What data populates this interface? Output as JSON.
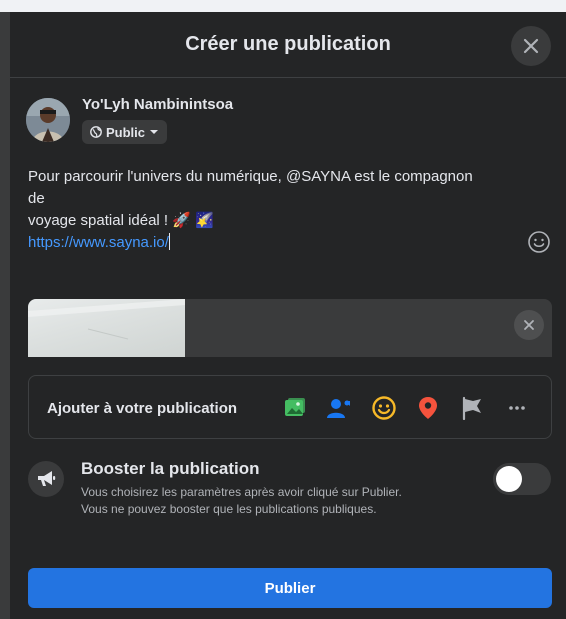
{
  "dialog": {
    "title": "Créer une publication",
    "close_icon": "close-icon"
  },
  "author": {
    "name": "Yo'Lyh Nambinintsoa",
    "audience": "Public",
    "audience_icon": "globe-icon",
    "audience_caret_icon": "caret-down-icon"
  },
  "post": {
    "line1": "Pour parcourir l'univers du numérique, @SAYNA est le compagnon",
    "line2": "de",
    "line3": "voyage spatial idéal ! 🚀 🌠",
    "link": "https://www.sayna.io/"
  },
  "emoji_button_icon": "smiley-outline-icon",
  "link_preview": {
    "remove_icon": "close-icon"
  },
  "add_to_post": {
    "label": "Ajouter à votre publication",
    "icons": [
      {
        "name": "photo-video-icon",
        "color": "#45bd62"
      },
      {
        "name": "tag-people-icon",
        "color": "#1877f2"
      },
      {
        "name": "feeling-activity-icon",
        "color": "#f7b928"
      },
      {
        "name": "check-in-icon",
        "color": "#f5533d"
      },
      {
        "name": "life-event-flag-icon",
        "color": "#b0b3b8"
      },
      {
        "name": "more-icon",
        "color": "#b0b3b8"
      }
    ]
  },
  "boost": {
    "title": "Booster la publication",
    "desc_line1": "Vous choisirez les paramètres après avoir cliqué sur Publier.",
    "desc_line2": "Vous ne pouvez booster que les publications publiques.",
    "icon": "megaphone-icon",
    "toggle_on": false
  },
  "publish_button": "Publier",
  "colors": {
    "accent": "#2374e1",
    "link": "#4599ff",
    "surface": "#242526"
  }
}
